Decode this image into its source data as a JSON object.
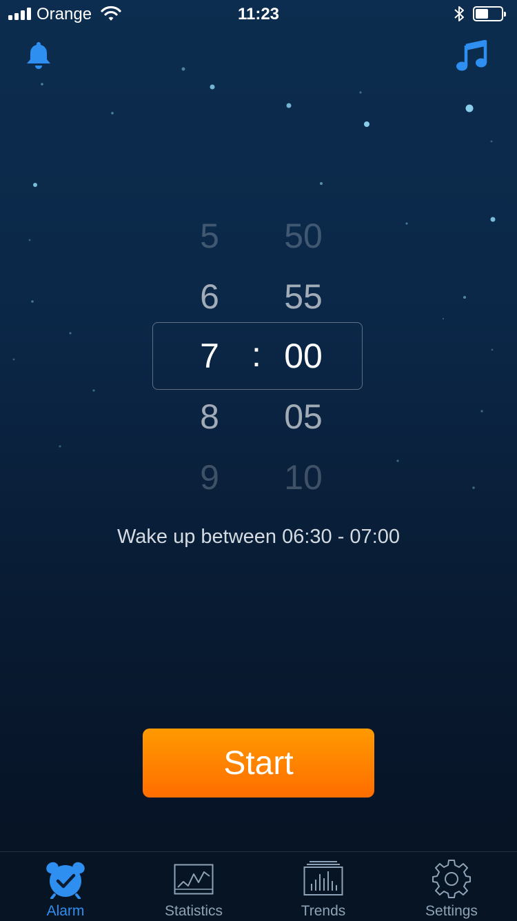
{
  "status_bar": {
    "carrier": "Orange",
    "time": "11:23",
    "battery_level": 0.5,
    "signal_bars": 4
  },
  "top": {
    "left_icon": "bell-icon",
    "right_icon": "music-note-icon",
    "accent_color": "#2f8ff0"
  },
  "picker": {
    "hours": [
      "5",
      "6",
      "7",
      "8",
      "9"
    ],
    "minutes": [
      "50",
      "55",
      "00",
      "05",
      "10"
    ],
    "separator": ":",
    "selected_hour": "7",
    "selected_minute": "00"
  },
  "wake_window_text": "Wake up between 06:30 - 07:00",
  "start_button": {
    "label": "Start",
    "color": "#ff8200"
  },
  "tabs": [
    {
      "label": "Alarm",
      "icon": "alarm-clock-icon",
      "active": true
    },
    {
      "label": "Statistics",
      "icon": "line-chart-icon",
      "active": false
    },
    {
      "label": "Trends",
      "icon": "bar-chart-icon",
      "active": false
    },
    {
      "label": "Settings",
      "icon": "gear-icon",
      "active": false
    }
  ],
  "colors": {
    "background_top": "#0c2d4f",
    "background_bottom": "#061223",
    "tab_active": "#2f8ff0",
    "tab_inactive": "#8ea3b7"
  }
}
